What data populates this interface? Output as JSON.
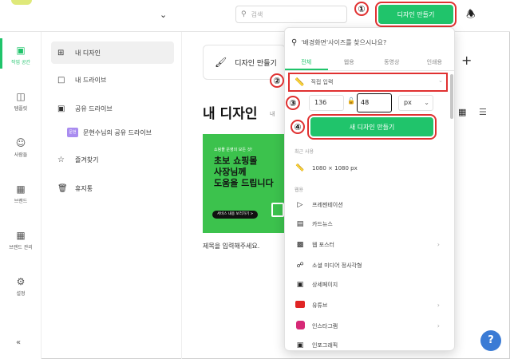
{
  "header": {
    "search_placeholder": "검색",
    "create_button": "디자인 만들기"
  },
  "rail": [
    {
      "label": "작업 공간",
      "icon": "workspace-icon"
    },
    {
      "label": "템플릿",
      "icon": "template-icon"
    },
    {
      "label": "사람들",
      "icon": "people-icon"
    },
    {
      "label": "브랜드",
      "icon": "brand-icon"
    },
    {
      "label": "브랜드 관리",
      "icon": "brand-manage-icon"
    },
    {
      "label": "설정",
      "icon": "gear-icon"
    }
  ],
  "sidebar": {
    "items": [
      {
        "label": "내 디자인"
      },
      {
        "label": "내 드라이브"
      },
      {
        "label": "공유 드라이브"
      },
      {
        "badge": "문현",
        "label": "문현수님의 공유 드라이브"
      },
      {
        "label": "즐겨찾기"
      },
      {
        "label": "휴지통"
      }
    ]
  },
  "main": {
    "create_card_label": "디자인 만들기",
    "page_title": "내 디자인",
    "title_sub": "내 ",
    "thumbnail": {
      "small_text": "쇼핑몰 운영의 모든 것!",
      "big_text_1": "초보 쇼핑몰",
      "big_text_2": "사장님께",
      "big_text_3": "도움을 드립니다",
      "pill_text": "서비스 내용 보러가기 >"
    },
    "doc_title": "제목을 입력해주세요."
  },
  "popup": {
    "search_placeholder": "'배경화면'사이즈를 찾으시나요?",
    "tabs": [
      "전체",
      "웹용",
      "동영상",
      "인쇄용"
    ],
    "custom_size_label": "직접 입력",
    "width": "136",
    "height": "48",
    "unit": "px",
    "create_button": "새 디자인 만들기",
    "recent_label": "최근 사용",
    "recent_item": "1080 × 1080 px",
    "web_label": "웹용",
    "items": [
      {
        "label": "프레젠테이션",
        "icon": "presentation-icon",
        "arrow": false
      },
      {
        "label": "카드뉴스",
        "icon": "cardnews-icon",
        "arrow": false
      },
      {
        "label": "웹 포스터",
        "icon": "poster-icon",
        "arrow": true
      },
      {
        "label": "소셜 미디어 정사각형",
        "icon": "share-icon",
        "arrow": false
      },
      {
        "label": "상세페이지",
        "icon": "detail-page-icon",
        "arrow": false
      },
      {
        "label": "유튜브",
        "icon": "youtube-icon",
        "arrow": true
      },
      {
        "label": "인스타그램",
        "icon": "instagram-icon",
        "arrow": true
      },
      {
        "label": "인포그래픽",
        "icon": "infographic-icon",
        "arrow": false
      }
    ]
  },
  "callouts": [
    "①",
    "②",
    "③",
    "④"
  ],
  "help_label": "?"
}
